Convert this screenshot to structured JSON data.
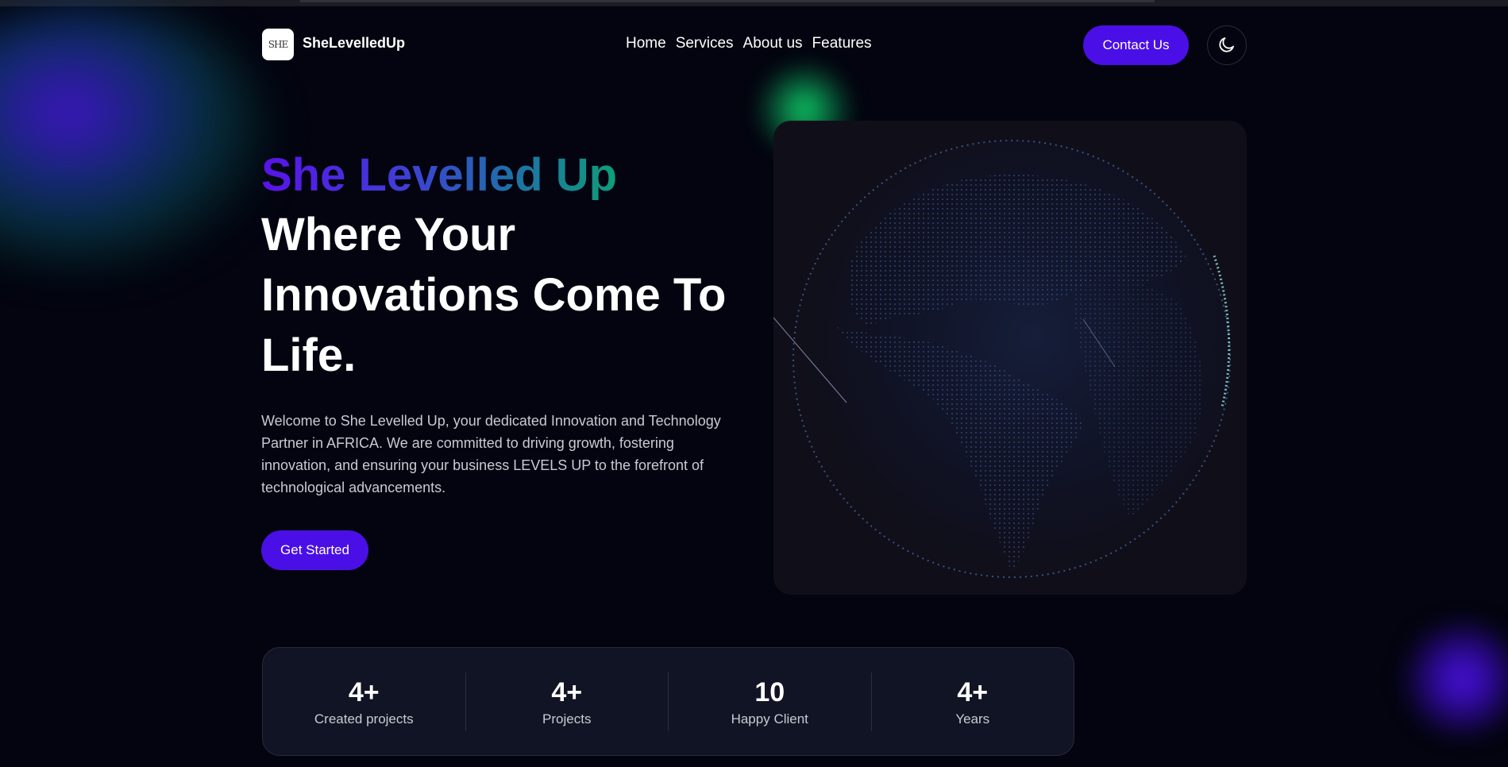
{
  "nav": {
    "logo_text": "SHE",
    "brand": "SheLevelledUp",
    "links": [
      "Home",
      "Services",
      "About us",
      "Features"
    ],
    "contact_label": "Contact Us",
    "theme_icon": "moon-icon"
  },
  "hero": {
    "accent": "She Levelled Up",
    "headline": "Where Your Innovations Come To Life.",
    "intro": "Welcome to She Levelled Up, your dedicated Innovation and Technology Partner in AFRICA. We are committed to driving growth, fostering innovation, and ensuring your business LEVELS UP to the forefront of technological advancements.",
    "cta_label": "Get Started",
    "image": "globe-image"
  },
  "stats": [
    {
      "value": "4+",
      "label": "Created projects"
    },
    {
      "value": "4+",
      "label": "Projects"
    },
    {
      "value": "10",
      "label": "Happy Client"
    },
    {
      "value": "4+",
      "label": "Years"
    }
  ],
  "colors": {
    "background": "#03040f",
    "accent": "#4a0fe6",
    "card": "#111424",
    "gradient_start": "#5a12e8",
    "gradient_end": "#0f9d7a"
  }
}
